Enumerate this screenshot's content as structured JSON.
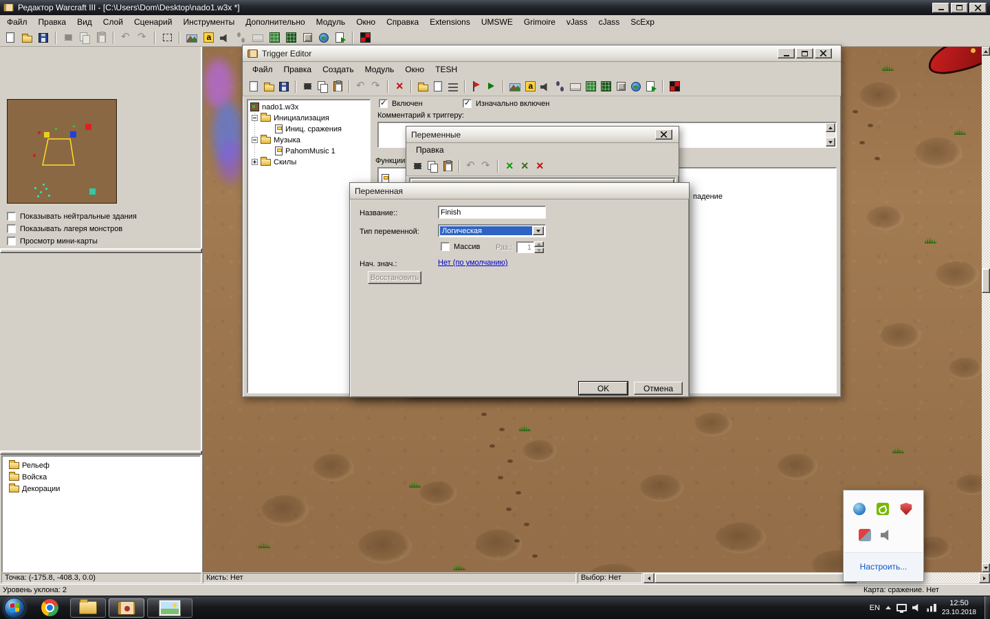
{
  "colors": {
    "desktop_gray": "#d4d0c8",
    "selection_blue": "#2e63c4",
    "link_blue": "#0a52c8",
    "terrain_brown": "#a27b52",
    "titlebar_dark": "#23262c"
  },
  "main_window": {
    "title": "Редактор Warcraft III  - [C:\\Users\\Dom\\Desktop\\nado1.w3x *]",
    "menus": [
      "Файл",
      "Правка",
      "Вид",
      "Слой",
      "Сценарий",
      "Инструменты",
      "Дополнительно",
      "Модуль",
      "Окно",
      "Справка",
      "Extensions",
      "UMSWE",
      "Grimoire",
      "vJass",
      "cJass",
      "ScExp"
    ],
    "toolbar_icons": [
      "new-map",
      "open-map",
      "save-map",
      "cut",
      "copy",
      "paste",
      "undo",
      "redo",
      "select-region",
      "terrain-editor",
      "text-labels",
      "sound-editor",
      "creeps",
      "shortcuts",
      "grid",
      "grid-dark",
      "object-editor",
      "world",
      "script-page",
      "test-map"
    ]
  },
  "sidebar": {
    "view_checkboxes": [
      {
        "label": "Показывать нейтральные здания",
        "checked": false
      },
      {
        "label": "Показывать лагеря монстров",
        "checked": false
      },
      {
        "label": "Просмотр мини-карты",
        "checked": false
      }
    ],
    "palette_tree": [
      "Рельеф",
      "Войска",
      "Декорации"
    ]
  },
  "trigger_editor": {
    "title": "Trigger Editor",
    "menus": [
      "Файл",
      "Правка",
      "Создать",
      "Модуль",
      "Окно",
      "TESH"
    ],
    "toolbar_icons": [
      "new",
      "open",
      "save",
      "cut",
      "copy",
      "paste",
      "undo",
      "redo",
      "delete",
      "new-category",
      "new-trigger",
      "new-comment",
      "run-trigger",
      "enable-trigger",
      "terrain-editor",
      "text-labels",
      "sound-editor",
      "creeps",
      "shortcuts",
      "grid",
      "grid-dark",
      "object-editor",
      "world",
      "export-script",
      "test-map"
    ],
    "tree": {
      "root": "nado1.w3x",
      "items": [
        {
          "label": "Инициализация",
          "type": "category-open"
        },
        {
          "label": "Иниц. сражения",
          "type": "trigger"
        },
        {
          "label": "Музыка",
          "type": "category-open"
        },
        {
          "label": "PahomMusic 1",
          "type": "trigger"
        },
        {
          "label": "Скилы",
          "type": "category-closed"
        }
      ]
    },
    "enabled_checkbox": {
      "label": "Включен",
      "checked": true
    },
    "initially_on_checkbox": {
      "label": "Изначально включен",
      "checked": true
    },
    "comment_label": "Комментарий к триггеру:",
    "comment_value": "",
    "functions_label": "Функции",
    "visible_text_fragment": "падение"
  },
  "variables_window": {
    "title": "Переменные",
    "menus": [
      "Правка"
    ],
    "toolbar_icons": [
      "cut",
      "copy",
      "paste",
      "undo",
      "redo",
      "new-variable",
      "rename-variable",
      "delete-variable"
    ]
  },
  "variable_dialog": {
    "title": "Переменная",
    "name_label": "Название::",
    "name_value": "Finish",
    "type_label": "Тип переменной:",
    "type_value": "Логическая",
    "array_checkbox": {
      "label": "Массив",
      "checked": false
    },
    "size_label": "Раз.:",
    "size_value": "1",
    "initial_label": "Нач. знач.:",
    "initial_value_link": "Нет (по умолчанию)",
    "restore_button": "Восстановить",
    "ok_button": "OK",
    "cancel_button": "Отмена"
  },
  "status_bar": {
    "point": "Точка: (-175.8, -408.3, 0.0)",
    "brush": "Кисть: Нет",
    "selection": "Выбор: Нет",
    "slope": "Уровень уклона: 2",
    "map": "Карта: сражение. Нет"
  },
  "taskbar": {
    "language": "EN",
    "time": "12:50",
    "date": "23.10.2018",
    "buttons": [
      "start",
      "chrome",
      "explorer",
      "warcraft-editor",
      "image-viewer"
    ],
    "tray_icons": [
      "hidden-icons-chevron",
      "display",
      "volume",
      "network-error"
    ]
  },
  "tray_popup": {
    "customize_link": "Настроить...",
    "icons": [
      "blue-app",
      "nvidia-settings",
      "security-shield",
      "media-app",
      "volume-mixer"
    ]
  }
}
